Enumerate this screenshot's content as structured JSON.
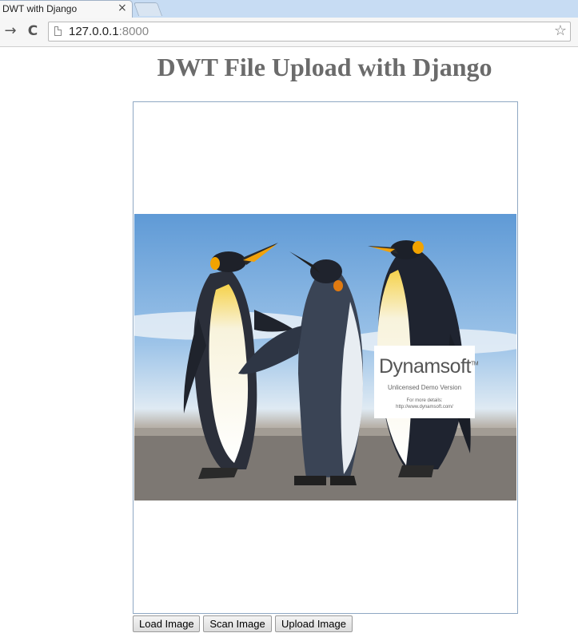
{
  "browser": {
    "tab_title": "DWT with Django",
    "tab_close": "×",
    "back_glyph": "→",
    "reload_glyph": "C",
    "url_host": "127.0.0.1",
    "url_port": ":8000",
    "star_glyph": "☆"
  },
  "page": {
    "title": "DWT File Upload with Django"
  },
  "viewer": {
    "watermark": {
      "brand": "Dynamsoft",
      "trademark": "TM",
      "line1": "Unlicensed Demo Version",
      "line2": "For more details:",
      "line3": "http://www.dynamsoft.com/"
    }
  },
  "buttons": {
    "load": "Load Image",
    "scan": "Scan Image",
    "upload": "Upload Image"
  },
  "colors": {
    "tab_strip": "#c7dcf3",
    "title_text": "#6b6b6b",
    "viewer_border": "#8fa8c3"
  }
}
